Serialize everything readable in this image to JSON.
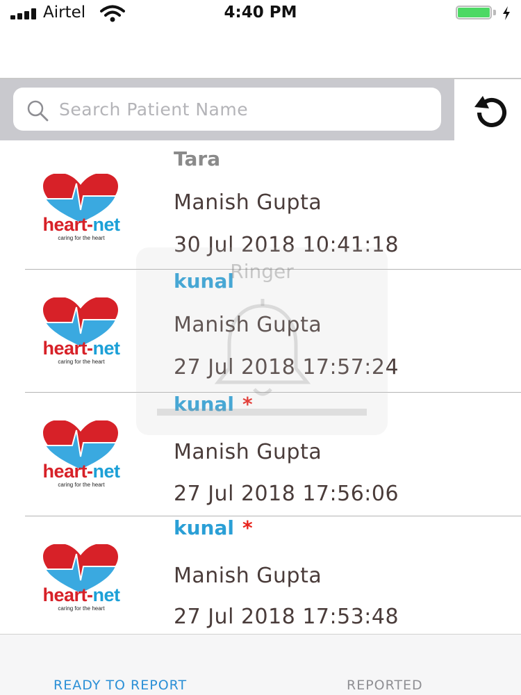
{
  "status_bar": {
    "carrier": "Airtel",
    "time": "4:40 PM"
  },
  "search": {
    "placeholder": "Search Patient Name",
    "value": ""
  },
  "patients": [
    {
      "author": "Tara",
      "patient": "Manish Gupta",
      "datetime": "30 Jul 2018 10:41:18",
      "flag": ""
    },
    {
      "author": "kunal",
      "patient": "Manish Gupta",
      "datetime": "27 Jul 2018 17:57:24",
      "flag": ""
    },
    {
      "author": "kunal",
      "patient": "Manish Gupta",
      "datetime": "27 Jul 2018 17:56:06",
      "flag": "*"
    },
    {
      "author": "kunal",
      "patient": "Manish Gupta",
      "datetime": "27 Jul 2018 17:53:48",
      "flag": "*"
    }
  ],
  "logo": {
    "brand_left": "heart",
    "brand_sep": "-",
    "brand_right": "net",
    "tagline": "caring for the heart"
  },
  "ringer": {
    "title": "Ringer"
  },
  "tabs": {
    "ready": "READY TO REPORT",
    "reported": "REPORTED"
  },
  "colors": {
    "accent": "#2a8fd6",
    "name_blue": "#2a9fd6",
    "name_grey": "#8a8a8a",
    "flag_red": "#e8241d",
    "battery_green": "#4cd964"
  },
  "icons": [
    "search-icon",
    "refresh-icon",
    "bell-icon",
    "wifi-icon",
    "signal-icon",
    "battery-icon",
    "charging-bolt-icon"
  ]
}
